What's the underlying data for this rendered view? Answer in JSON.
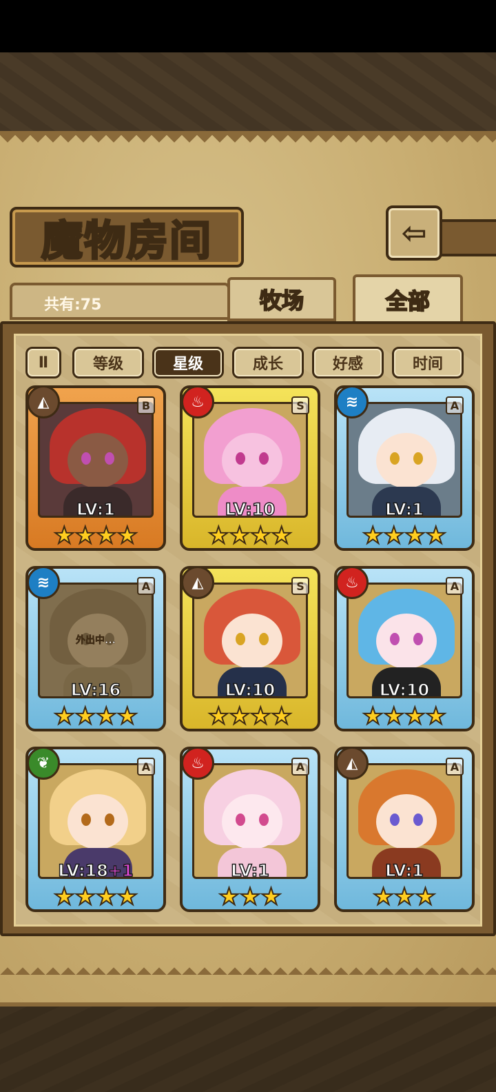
{
  "screen": {
    "title": "魔物房间",
    "back_icon": "⇦",
    "count_label": "共有:75",
    "tabs": [
      {
        "label": "牧场"
      },
      {
        "label": "全部"
      }
    ],
    "sort_buttons": [
      {
        "label": "Ⅱ"
      },
      {
        "label": "等级"
      },
      {
        "label": "星级"
      },
      {
        "label": "成长"
      },
      {
        "label": "好感"
      },
      {
        "label": "时间"
      }
    ],
    "active_sort": "星级"
  },
  "monsters": [
    {
      "frame": "orange",
      "element": "earth",
      "element_glyph": "◭",
      "rank": "B",
      "level": "LV:1",
      "stars": 4,
      "stars_text": "★★★★"
    },
    {
      "frame": "yellow",
      "element": "fire",
      "element_glyph": "♨",
      "rank": "S",
      "level": "LV:10",
      "stars": 4,
      "stars_text": "★★★★"
    },
    {
      "frame": "blue",
      "element": "water",
      "element_glyph": "≋",
      "rank": "A",
      "level": "LV:1",
      "stars": 4,
      "stars_text": "★★★★"
    },
    {
      "frame": "blue",
      "element": "water",
      "element_glyph": "≋",
      "rank": "A",
      "level": "LV:16",
      "stars": 4,
      "stars_text": "★★★★",
      "status": "外出中..."
    },
    {
      "frame": "yellow",
      "element": "earth",
      "element_glyph": "◭",
      "rank": "S",
      "level": "LV:10",
      "stars": 4,
      "stars_text": "★★★★"
    },
    {
      "frame": "blue",
      "element": "fire",
      "element_glyph": "♨",
      "rank": "A",
      "level": "LV:10",
      "stars": 4,
      "stars_text": "★★★★"
    },
    {
      "frame": "blue",
      "element": "wood",
      "element_glyph": "❦",
      "rank": "A",
      "level": "LV:18",
      "level_bonus": "+1",
      "stars": 4,
      "stars_text": "★★★★"
    },
    {
      "frame": "blue",
      "element": "fire",
      "element_glyph": "♨",
      "rank": "A",
      "level": "LV:1",
      "stars": 3,
      "stars_text": "★★★"
    },
    {
      "frame": "blue",
      "element": "earth",
      "element_glyph": "◭",
      "rank": "A",
      "level": "LV:1",
      "stars": 3,
      "stars_text": "★★★"
    }
  ],
  "colors": {
    "earth": "#6b4a2e",
    "fire": "#d1231f",
    "water": "#1e7fc4",
    "wood": "#3a8a2a"
  }
}
